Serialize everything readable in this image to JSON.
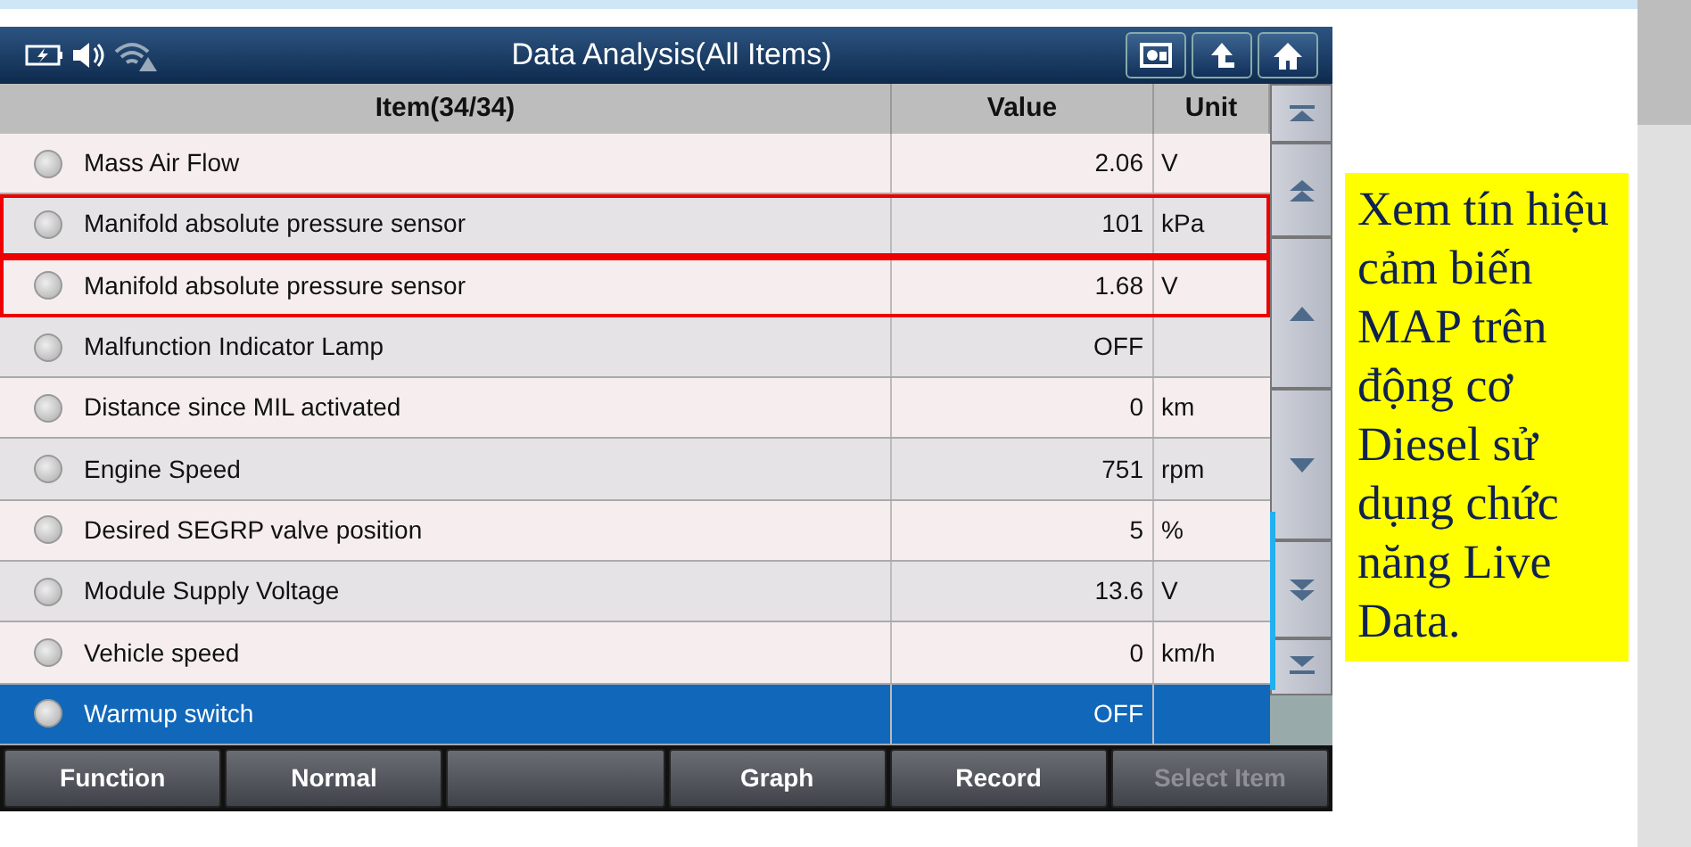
{
  "window": {
    "title": "Data Analysis(All Items)"
  },
  "table": {
    "columns": [
      "Item(34/34)",
      "Value",
      "Unit"
    ],
    "rows": [
      {
        "item": "Mass Air Flow",
        "value": "2.06",
        "unit": "V",
        "selected": false,
        "highlighted": false
      },
      {
        "item": "Manifold absolute pressure sensor",
        "value": "101",
        "unit": "kPa",
        "selected": false,
        "highlighted": true
      },
      {
        "item": "Manifold absolute pressure sensor",
        "value": "1.68",
        "unit": "V",
        "selected": false,
        "highlighted": true
      },
      {
        "item": "Malfunction Indicator Lamp",
        "value": "OFF",
        "selected": false,
        "highlighted": false
      },
      {
        "item": "Distance since MIL activated",
        "value": "0",
        "unit": "km",
        "selected": false,
        "highlighted": false
      },
      {
        "item": "Engine Speed",
        "value": "751",
        "unit": "rpm",
        "selected": false,
        "highlighted": false
      },
      {
        "item": "Desired SEGRP valve position",
        "value": "5",
        "unit": "%",
        "selected": false,
        "highlighted": false
      },
      {
        "item": "Module Supply Voltage",
        "value": "13.6",
        "unit": "V",
        "selected": false,
        "highlighted": false
      },
      {
        "item": "Vehicle speed",
        "value": "0",
        "unit": "km/h",
        "selected": false,
        "highlighted": false
      },
      {
        "item": "Warmup switch",
        "value": "OFF",
        "selected": true,
        "highlighted": false
      }
    ]
  },
  "buttons": [
    {
      "label": "Function",
      "disabled": false
    },
    {
      "label": "Normal",
      "disabled": false
    },
    {
      "disabled": false
    },
    {
      "label": "Graph",
      "disabled": false
    },
    {
      "label": "Record",
      "disabled": false
    },
    {
      "label": "Select Item",
      "disabled": true
    }
  ],
  "note": {
    "text": "Xem tín hiệu cảm biến MAP trên động cơ Diesel sử dụng chức năng Live Data."
  }
}
